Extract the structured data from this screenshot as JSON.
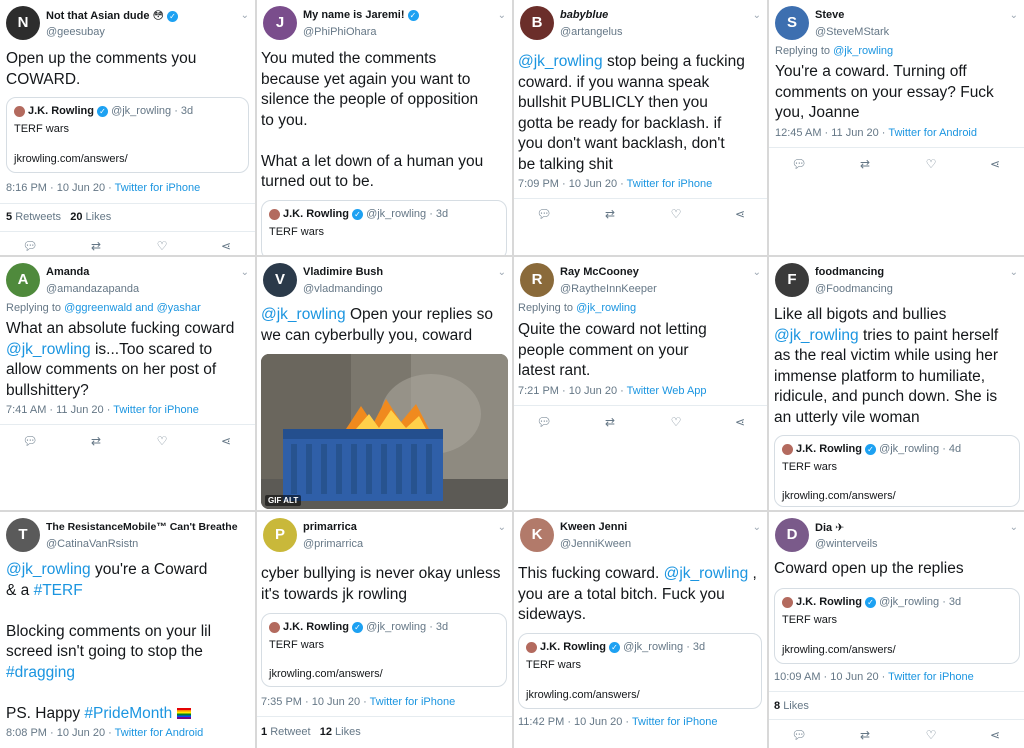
{
  "quoted": {
    "name": "J.K. Rowling",
    "handle": "@jk_rowling",
    "body": "TERF wars",
    "link": "jkrowling.com/answers/"
  },
  "tweets": [
    {
      "name": "Not that Asian dude 😳",
      "handle": "@geesubay",
      "lines": [
        "Open up the comments you",
        "COWARD."
      ],
      "quote_age": "· 3d",
      "meta_time": "8:16 PM · 10 Jun 20 · ",
      "meta_source": "Twitter for iPhone",
      "retweets": "5",
      "retweets_label": "Retweets",
      "likes": "20",
      "likes_label": "Likes"
    },
    {
      "name": "My name is Jaremi!",
      "handle": "@PhiPhiOhara",
      "lines": [
        "You muted the comments",
        "because yet again you want to",
        "silence the people of opposition",
        "to you.",
        "",
        "What a let down of a human you",
        "turned out to be."
      ],
      "quote_age": "· 3d"
    },
    {
      "name": "babyblue",
      "handle": "@artangelus",
      "line1_mention": "@jk_rowling",
      "line1_rest": " stop being a fucking",
      "lines": [
        "coward. if you wanna speak",
        "bullshit PUBLICLY then you",
        "gotta be ready for backlash. if",
        "you don't want backlash, don't",
        "be talking shit"
      ],
      "meta_time": "7:09 PM · 10 Jun 20 · ",
      "meta_source": "Twitter for iPhone"
    },
    {
      "name": "Steve",
      "handle": "@SteveMStark",
      "replying_prefix": "Replying to ",
      "replying_to": "@jk_rowling",
      "lines": [
        "You're a coward. Turning off",
        "comments on your essay? Fuck",
        "you, Joanne"
      ],
      "meta_time": "12:45 AM · 11 Jun 20 · ",
      "meta_source": "Twitter for Android"
    },
    {
      "name": "Amanda",
      "handle": "@amandazapanda",
      "replying_prefix": "Replying to ",
      "replying_to": "@ggreenwald and @yashar",
      "lines": [
        "What an absolute fucking coward"
      ],
      "line2_mention": "@jk_rowling",
      "line2_rest": " is...Too scared to",
      "lines_after": [
        "allow comments on her post of",
        "bullshittery?"
      ],
      "meta_time": "7:41 AM · 11 Jun 20 · ",
      "meta_source": "Twitter for iPhone"
    },
    {
      "name": "Vladimire Bush",
      "handle": "@vladmandingo",
      "line1_mention": "@jk_rowling",
      "line1_rest": " Open your replies so",
      "lines": [
        "we can cyberbully you, coward"
      ],
      "media_badge": "GIF  ALT"
    },
    {
      "name": "Ray McCooney",
      "handle": "@RaytheInnKeeper",
      "replying_prefix": "Replying to ",
      "replying_to": "@jk_rowling",
      "lines": [
        "Quite the coward not letting",
        "people comment on your",
        "latest rant."
      ],
      "meta_time": "7:21 PM · 10 Jun 20 · ",
      "meta_source": "Twitter Web App"
    },
    {
      "name": "foodmancing",
      "handle": "@Foodmancing",
      "lines": [
        "Like all bigots and bullies"
      ],
      "line2_mention": "@jk_rowling",
      "line2_rest": " tries to paint herself",
      "lines_after": [
        "as the real victim while using her",
        "immense platform to humiliate,",
        "ridicule, and punch down. She is",
        "an utterly vile woman"
      ],
      "quote_age": "· 4d"
    },
    {
      "name": "The ResistanceMobile™ Can't Breathe",
      "handle": "@CatinaVanRsistn",
      "line1_mention": "@jk_rowling",
      "line1_rest": " you're a Coward",
      "line2_pre": "& a ",
      "line2_tag": "#TERF",
      "lines": [
        "Blocking comments on your lil",
        "screed isn't going to stop the"
      ],
      "line_tag": "#dragging",
      "ps_pre": "PS. Happy ",
      "ps_tag": "#PrideMonth",
      "meta_time": "8:08 PM · 10 Jun 20 · ",
      "meta_source": "Twitter for Android"
    },
    {
      "name": "primarrica",
      "handle": "@primarrica",
      "lines": [
        "cyber bullying is never okay unless",
        "it's towards jk rowling"
      ],
      "quote_age": "· 3d",
      "meta_time": "7:35 PM · 10 Jun 20 · ",
      "meta_source": "Twitter for iPhone",
      "retweets": "1",
      "retweets_label": "Retweet",
      "likes": "12",
      "likes_label": "Likes"
    },
    {
      "name": "Kween Jenni",
      "handle": "@JenniKween",
      "line1_pre": "This fucking coward. ",
      "line1_mention": "@jk_rowling",
      "line1_rest": " ,",
      "lines": [
        "you are a total bitch. Fuck you",
        "sideways."
      ],
      "quote_age": "· 3d",
      "meta_time": "11:42 PM · 10 Jun 20 · ",
      "meta_source": "Twitter for iPhone"
    },
    {
      "name": "Dia ✈",
      "handle": "@winterveils",
      "lines": [
        "Coward open up the replies"
      ],
      "quote_age": "· 3d",
      "meta_time": "10:09 AM · 10 Jun 20 · ",
      "meta_source": "Twitter for iPhone",
      "likes": "8",
      "likes_label": "Likes"
    }
  ],
  "icons": [
    "reply-icon",
    "retweet-icon",
    "like-icon",
    "share-icon"
  ],
  "colors": {
    "link": "#1b95e0",
    "muted": "#657786",
    "verified": "#1da1f2"
  }
}
